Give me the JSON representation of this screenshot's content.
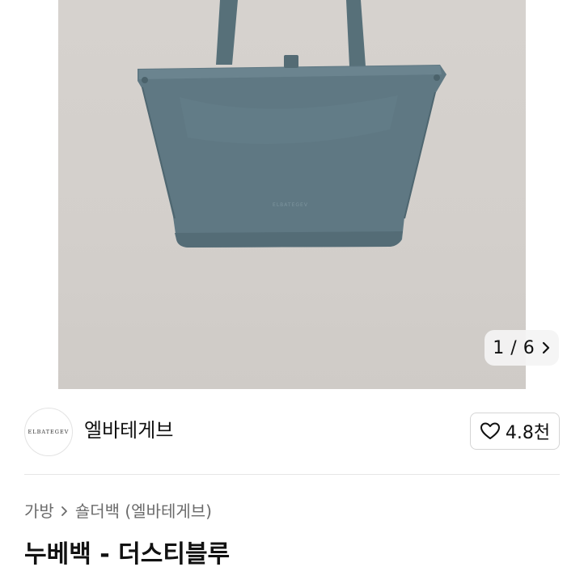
{
  "gallery": {
    "counter_current": "1",
    "counter_separator": "/",
    "counter_total": "6",
    "next_icon": "chevron-right-icon",
    "product_logo_text": "ELBATEGEV"
  },
  "seller": {
    "avatar_text": "ELBATEGEV",
    "name": "엘바테게브"
  },
  "like": {
    "icon": "heart-outline-icon",
    "count": "4.8천"
  },
  "breadcrumb": {
    "category": "가방",
    "separator_icon": "chevron-right-icon",
    "subcategory": "숄더백 (엘바테게브)"
  },
  "product": {
    "title": "누베백 - 더스티블루"
  },
  "colors": {
    "bag": "#5e7782",
    "background": "#d4d0cc"
  }
}
